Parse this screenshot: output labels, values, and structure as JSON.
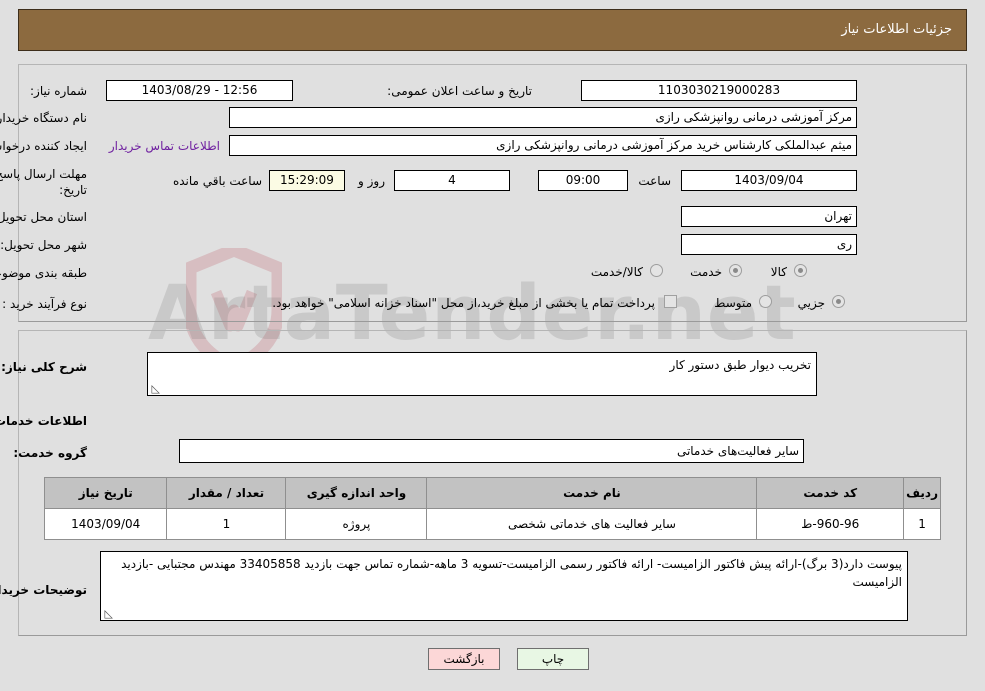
{
  "header": {
    "title": "جزئیات اطلاعات نیاز"
  },
  "watermark": {
    "text": "ArtaTender.net"
  },
  "form": {
    "need_number_label": "شماره نیاز:",
    "need_number_value": "1103030219000283",
    "public_announce_label": "تاریخ و ساعت اعلان عمومی:",
    "public_announce_value": "1403/08/29 - 12:56",
    "buyer_org_label": "نام دستگاه خریدار:",
    "buyer_org_value": "مرکز آموزشی درمانی روانپزشکی رازی",
    "requester_label": "ایجاد کننده درخواست:",
    "requester_value": "میثم عبدالملکی کارشناس خرید مرکز آموزشی درمانی روانپزشکی رازی",
    "buyer_contact_link": "اطلاعات تماس خریدار",
    "deadline_label_line1": "مهلت ارسال پاسخ: تا",
    "deadline_label_line2": "تاریخ:",
    "deadline_date": "1403/09/04",
    "deadline_time_label": "ساعت",
    "deadline_time": "09:00",
    "remaining_days": "4",
    "remaining_days_label": "روز و",
    "remaining_clock": "15:29:09",
    "remaining_clock_label": "ساعت باقي مانده",
    "province_label": "استان محل تحویل:",
    "province_value": "تهران",
    "city_label": "شهر محل تحویل:",
    "city_value": "ری",
    "category_label": "طبقه بندی موضوعی:",
    "category_options": [
      {
        "label": "کالا",
        "selected": false
      },
      {
        "label": "خدمت",
        "selected": true
      },
      {
        "label": "کالا/خدمت",
        "selected": false
      }
    ],
    "process_type_label": "نوع فرآیند خرید :",
    "process_type_options": [
      {
        "label": "جزیي",
        "selected": true
      },
      {
        "label": "متوسط",
        "selected": false
      }
    ],
    "treasury_checkbox_checked": false,
    "treasury_note": "پرداخت تمام یا بخشی از مبلغ خرید،از محل \"اسناد خزانه اسلامی\" خواهد بود."
  },
  "details": {
    "general_desc_label": "شرح کلی نیاز:",
    "general_desc_value": "تخریب دیوار طبق دستور کار",
    "services_info_heading": "اطلاعات خدمات مورد نیاز",
    "service_group_label": "گروه خدمت:",
    "service_group_value": "سایر فعالیت‌های خدماتی",
    "buyer_notes_label": "توضیحات خریدار:",
    "buyer_notes_value": "پیوست دارد(3 برگ)-ارائه پیش فاکتور الزامیست- ارائه فاکتور رسمی الزامیست-تسویه 3 ماهه-شماره تماس جهت بازدید 33405858 مهندس مجتبایی -بازدید الزامیست"
  },
  "table": {
    "columns": [
      "ردیف",
      "کد خدمت",
      "نام خدمت",
      "واحد اندازه گیری",
      "تعداد / مقدار",
      "تاریخ نیاز"
    ],
    "rows": [
      {
        "row": "1",
        "code": "960-96-ط",
        "name": "سایر فعالیت های خدماتی شخصی",
        "unit": "پروژه",
        "qty": "1",
        "date": "1403/09/04"
      }
    ]
  },
  "buttons": {
    "print": "چاپ",
    "back": "بازگشت"
  },
  "colors": {
    "header_bar": "#8c6a3f",
    "page_background": "#e0e0e0",
    "link": "#6f20a0",
    "table_header": "#c2c2c2",
    "print_button": "#e8f7e4",
    "back_button": "#fcd7d7",
    "highlight_field": "#fbfbe4"
  }
}
